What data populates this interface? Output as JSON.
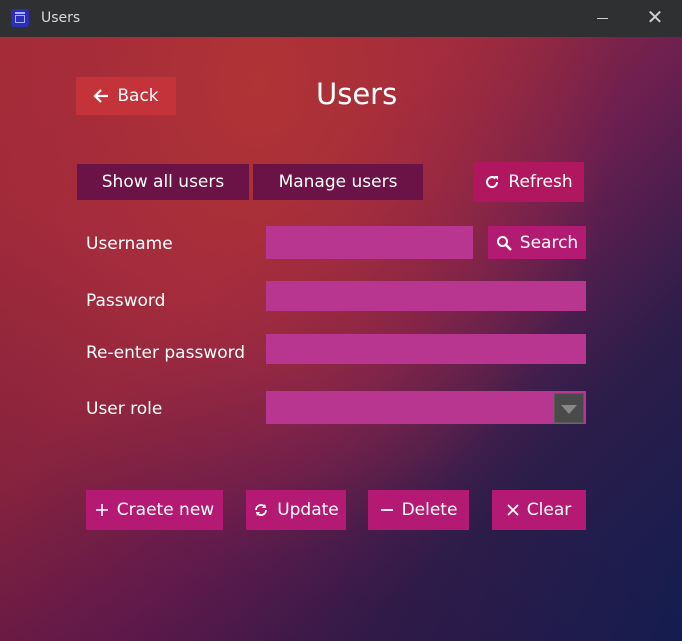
{
  "window": {
    "title": "Users",
    "app_icon": "calendar-icon",
    "minimize_icon": "minimize-icon",
    "close_icon": "close-icon"
  },
  "header": {
    "back_label": "Back",
    "back_icon": "arrow-left-icon",
    "page_title": "Users"
  },
  "tabs": [
    {
      "label": "Show all users"
    },
    {
      "label": "Manage users"
    }
  ],
  "refresh": {
    "label": "Refresh",
    "icon": "refresh-icon"
  },
  "form": {
    "username_label": "Username",
    "username_value": "",
    "search_label": "Search",
    "search_icon": "search-icon",
    "password_label": "Password",
    "password_value": "",
    "reenter_label": "Re-enter password",
    "reenter_value": "",
    "role_label": "User role",
    "role_value": ""
  },
  "actions": [
    {
      "label": "Craete new",
      "icon": "plus-icon"
    },
    {
      "label": "Update",
      "icon": "sync-icon"
    },
    {
      "label": "Delete",
      "icon": "minus-icon"
    },
    {
      "label": "Clear",
      "icon": "x-icon"
    }
  ],
  "colors": {
    "accent": "#b31b73",
    "tab_bg": "#6b1246",
    "input_bg": "#b83590",
    "back_bg": "#c4323a"
  }
}
